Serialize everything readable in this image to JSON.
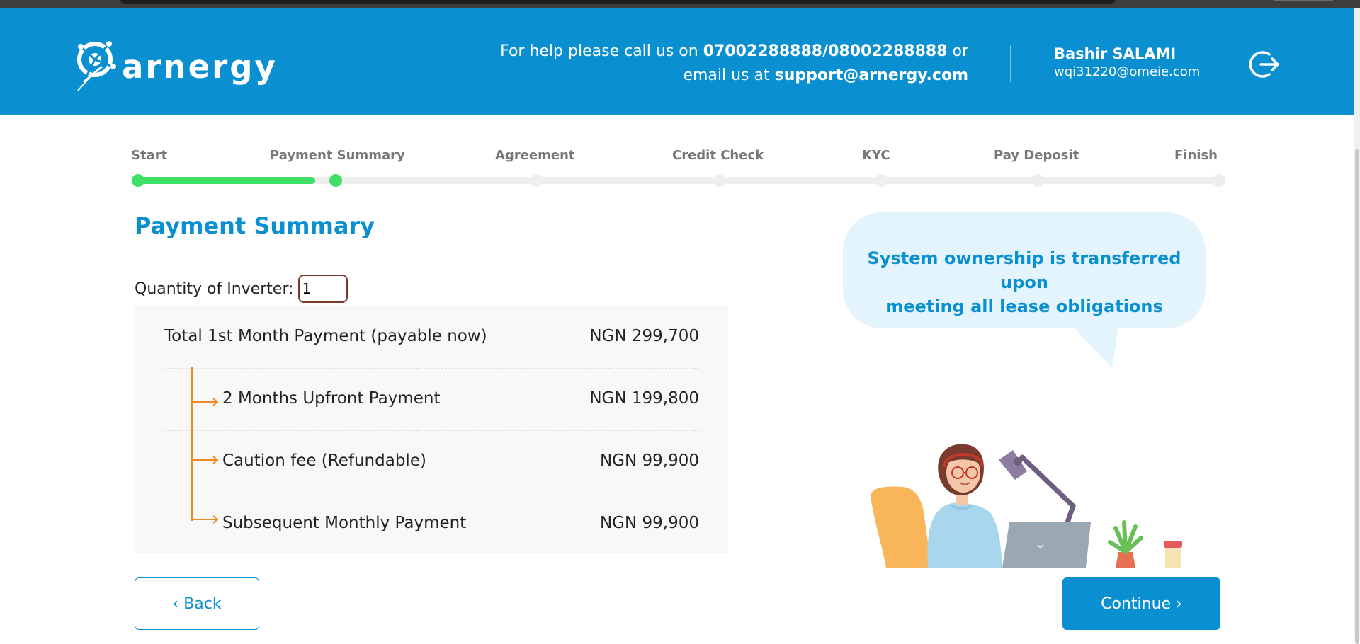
{
  "brand": {
    "name": "arnergy",
    "color": "#0a8fd1"
  },
  "header": {
    "help_prefix": "For help please call us on ",
    "phone": "07002288888/08002288888",
    "help_mid": " or",
    "help_email_prefix": "email us at ",
    "email": "support@arnergy.com",
    "user_name": "Bashir SALAMI",
    "user_email": "wqi31220@omeie.com",
    "logout_icon": "logout-icon"
  },
  "stepper": {
    "steps": [
      "Start",
      "Payment Summary",
      "Agreement",
      "Credit Check",
      "KYC",
      "Pay Deposit",
      "Finish"
    ],
    "current_step": 2,
    "completed_color": "#3fdf68"
  },
  "page": {
    "title": "Payment Summary",
    "quantity_label": "Quantity of Inverter:",
    "quantity_value": "1"
  },
  "summary": {
    "total_label": "Total 1st Month Payment (payable now)",
    "total_value": "NGN 299,700",
    "items": [
      {
        "label": "2 Months Upfront Payment",
        "value": "NGN 199,800"
      },
      {
        "label": "Caution fee (Refundable)",
        "value": "NGN 99,900"
      },
      {
        "label": "Subsequent Monthly Payment",
        "value": "NGN 99,900"
      }
    ],
    "tree_color": "#f08a24"
  },
  "callout": {
    "line1": "System ownership is transferred upon",
    "line2": "meeting all lease obligations"
  },
  "actions": {
    "back_label": "‹ Back",
    "continue_label": "Continue ›"
  }
}
